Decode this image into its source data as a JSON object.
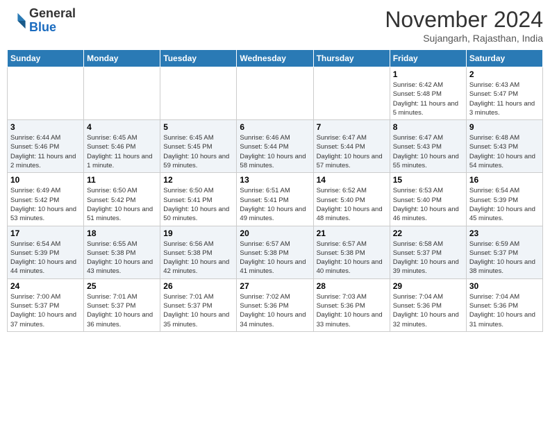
{
  "header": {
    "logo_line1": "General",
    "logo_line2": "Blue",
    "month": "November 2024",
    "location": "Sujangarh, Rajasthan, India"
  },
  "weekdays": [
    "Sunday",
    "Monday",
    "Tuesday",
    "Wednesday",
    "Thursday",
    "Friday",
    "Saturday"
  ],
  "weeks": [
    [
      {
        "day": "",
        "info": ""
      },
      {
        "day": "",
        "info": ""
      },
      {
        "day": "",
        "info": ""
      },
      {
        "day": "",
        "info": ""
      },
      {
        "day": "",
        "info": ""
      },
      {
        "day": "1",
        "info": "Sunrise: 6:42 AM\nSunset: 5:48 PM\nDaylight: 11 hours and 5 minutes."
      },
      {
        "day": "2",
        "info": "Sunrise: 6:43 AM\nSunset: 5:47 PM\nDaylight: 11 hours and 3 minutes."
      }
    ],
    [
      {
        "day": "3",
        "info": "Sunrise: 6:44 AM\nSunset: 5:46 PM\nDaylight: 11 hours and 2 minutes."
      },
      {
        "day": "4",
        "info": "Sunrise: 6:45 AM\nSunset: 5:46 PM\nDaylight: 11 hours and 1 minute."
      },
      {
        "day": "5",
        "info": "Sunrise: 6:45 AM\nSunset: 5:45 PM\nDaylight: 10 hours and 59 minutes."
      },
      {
        "day": "6",
        "info": "Sunrise: 6:46 AM\nSunset: 5:44 PM\nDaylight: 10 hours and 58 minutes."
      },
      {
        "day": "7",
        "info": "Sunrise: 6:47 AM\nSunset: 5:44 PM\nDaylight: 10 hours and 57 minutes."
      },
      {
        "day": "8",
        "info": "Sunrise: 6:47 AM\nSunset: 5:43 PM\nDaylight: 10 hours and 55 minutes."
      },
      {
        "day": "9",
        "info": "Sunrise: 6:48 AM\nSunset: 5:43 PM\nDaylight: 10 hours and 54 minutes."
      }
    ],
    [
      {
        "day": "10",
        "info": "Sunrise: 6:49 AM\nSunset: 5:42 PM\nDaylight: 10 hours and 53 minutes."
      },
      {
        "day": "11",
        "info": "Sunrise: 6:50 AM\nSunset: 5:42 PM\nDaylight: 10 hours and 51 minutes."
      },
      {
        "day": "12",
        "info": "Sunrise: 6:50 AM\nSunset: 5:41 PM\nDaylight: 10 hours and 50 minutes."
      },
      {
        "day": "13",
        "info": "Sunrise: 6:51 AM\nSunset: 5:41 PM\nDaylight: 10 hours and 49 minutes."
      },
      {
        "day": "14",
        "info": "Sunrise: 6:52 AM\nSunset: 5:40 PM\nDaylight: 10 hours and 48 minutes."
      },
      {
        "day": "15",
        "info": "Sunrise: 6:53 AM\nSunset: 5:40 PM\nDaylight: 10 hours and 46 minutes."
      },
      {
        "day": "16",
        "info": "Sunrise: 6:54 AM\nSunset: 5:39 PM\nDaylight: 10 hours and 45 minutes."
      }
    ],
    [
      {
        "day": "17",
        "info": "Sunrise: 6:54 AM\nSunset: 5:39 PM\nDaylight: 10 hours and 44 minutes."
      },
      {
        "day": "18",
        "info": "Sunrise: 6:55 AM\nSunset: 5:38 PM\nDaylight: 10 hours and 43 minutes."
      },
      {
        "day": "19",
        "info": "Sunrise: 6:56 AM\nSunset: 5:38 PM\nDaylight: 10 hours and 42 minutes."
      },
      {
        "day": "20",
        "info": "Sunrise: 6:57 AM\nSunset: 5:38 PM\nDaylight: 10 hours and 41 minutes."
      },
      {
        "day": "21",
        "info": "Sunrise: 6:57 AM\nSunset: 5:38 PM\nDaylight: 10 hours and 40 minutes."
      },
      {
        "day": "22",
        "info": "Sunrise: 6:58 AM\nSunset: 5:37 PM\nDaylight: 10 hours and 39 minutes."
      },
      {
        "day": "23",
        "info": "Sunrise: 6:59 AM\nSunset: 5:37 PM\nDaylight: 10 hours and 38 minutes."
      }
    ],
    [
      {
        "day": "24",
        "info": "Sunrise: 7:00 AM\nSunset: 5:37 PM\nDaylight: 10 hours and 37 minutes."
      },
      {
        "day": "25",
        "info": "Sunrise: 7:01 AM\nSunset: 5:37 PM\nDaylight: 10 hours and 36 minutes."
      },
      {
        "day": "26",
        "info": "Sunrise: 7:01 AM\nSunset: 5:37 PM\nDaylight: 10 hours and 35 minutes."
      },
      {
        "day": "27",
        "info": "Sunrise: 7:02 AM\nSunset: 5:36 PM\nDaylight: 10 hours and 34 minutes."
      },
      {
        "day": "28",
        "info": "Sunrise: 7:03 AM\nSunset: 5:36 PM\nDaylight: 10 hours and 33 minutes."
      },
      {
        "day": "29",
        "info": "Sunrise: 7:04 AM\nSunset: 5:36 PM\nDaylight: 10 hours and 32 minutes."
      },
      {
        "day": "30",
        "info": "Sunrise: 7:04 AM\nSunset: 5:36 PM\nDaylight: 10 hours and 31 minutes."
      }
    ]
  ]
}
